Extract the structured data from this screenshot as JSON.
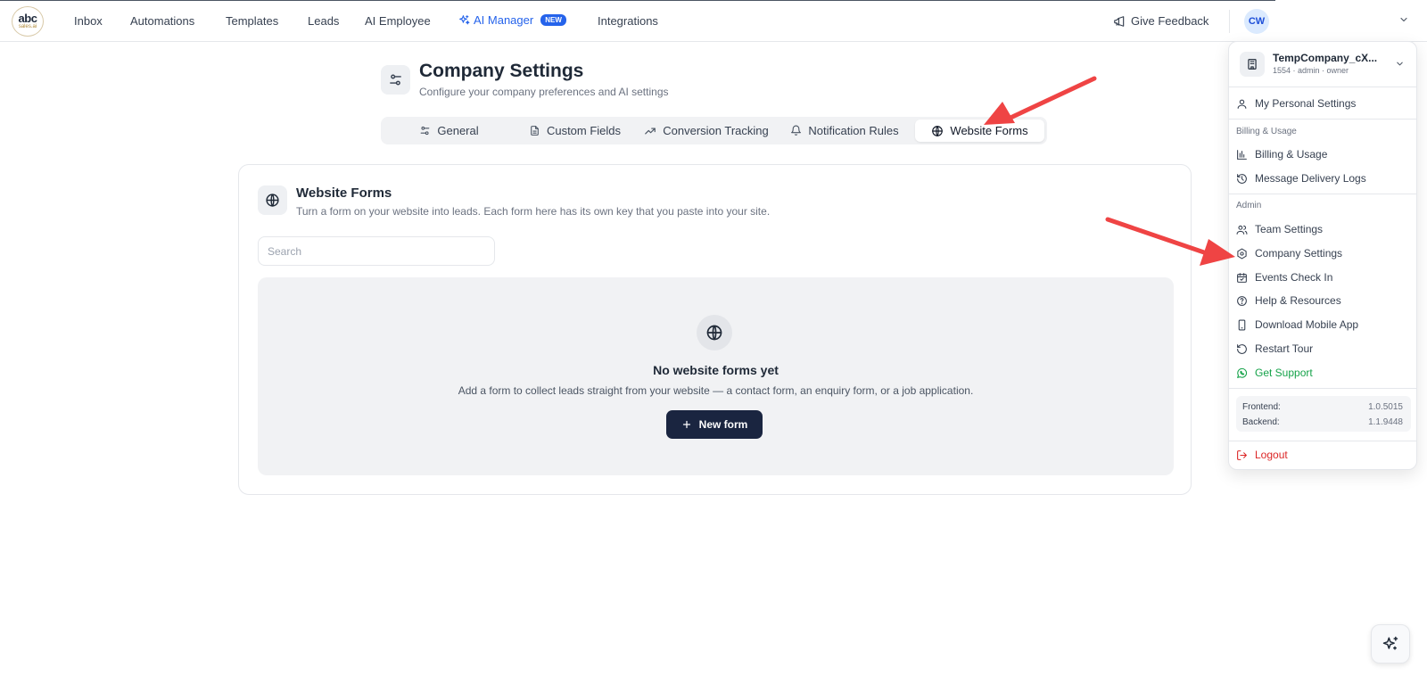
{
  "logo": {
    "line1": "abc",
    "line2": "sales.ai"
  },
  "nav": {
    "inbox": "Inbox",
    "automations": "Automations",
    "templates": "Templates",
    "leads": "Leads",
    "ai_employee": "AI Employee",
    "ai_manager": "AI Manager",
    "ai_manager_badge": "NEW",
    "integrations": "Integrations",
    "feedback": "Give Feedback",
    "avatar_initials": "CW"
  },
  "header": {
    "title": "Company Settings",
    "subtitle": "Configure your company preferences and AI settings"
  },
  "tabs": [
    {
      "label": "General",
      "icon": "sliders-icon"
    },
    {
      "label": "Custom Fields",
      "icon": "document-icon"
    },
    {
      "label": "Conversion Tracking",
      "icon": "trending-up-icon"
    },
    {
      "label": "Notification Rules",
      "icon": "bell-icon"
    },
    {
      "label": "Website Forms",
      "icon": "globe-icon",
      "active": true
    }
  ],
  "card": {
    "title": "Website Forms",
    "subtitle": "Turn a form on your website into leads. Each form here has its own key that you paste into your site.",
    "search_placeholder": "Search",
    "empty_title": "No website forms yet",
    "empty_subtitle": "Add a form to collect leads straight from your website — a contact form, an enquiry form, or a job application.",
    "new_button": "New form"
  },
  "dropdown": {
    "company_name": "TempCompany_cX...",
    "company_meta": "1554 · admin · owner",
    "personal_settings": "My Personal Settings",
    "section_billing": "Billing & Usage",
    "billing": "Billing & Usage",
    "delivery_logs": "Message Delivery Logs",
    "section_admin": "Admin",
    "team_settings": "Team Settings",
    "company_settings": "Company Settings",
    "events_check_in": "Events Check In",
    "help": "Help & Resources",
    "mobile_app": "Download Mobile App",
    "restart_tour": "Restart Tour",
    "support": "Get Support",
    "frontend_label": "Frontend:",
    "frontend_version": "1.0.5015",
    "backend_label": "Backend:",
    "backend_version": "1.1.9448",
    "logout": "Logout"
  },
  "colors": {
    "accent": "#2563eb",
    "primary_button": "#1a2540",
    "annotation_arrow": "#ef4444",
    "support": "#16a34a",
    "logout": "#dc2626"
  }
}
